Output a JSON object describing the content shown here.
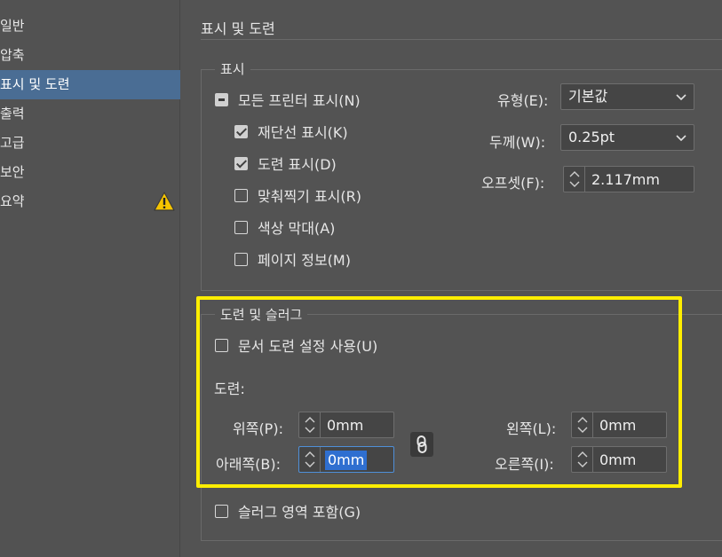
{
  "sidebar": {
    "items": [
      {
        "label": "일반"
      },
      {
        "label": "압축"
      },
      {
        "label": "표시 및 도련",
        "active": true
      },
      {
        "label": "출력"
      },
      {
        "label": "고급"
      },
      {
        "label": "보안"
      },
      {
        "label": "요약",
        "warning": true
      }
    ],
    "warning_icon": "warning-triangle-icon"
  },
  "panel": {
    "title": "표시 및 도련",
    "marks": {
      "legend": "표시",
      "all_printer_marks": {
        "label": "모든 프린터 표시(N)",
        "state": "mixed"
      },
      "crop_marks": {
        "label": "재단선 표시(K)",
        "checked": true
      },
      "bleed_marks": {
        "label": "도련 표시(D)",
        "checked": true
      },
      "registration_marks": {
        "label": "맞춰찍기 표시(R)",
        "checked": false
      },
      "color_bars": {
        "label": "색상 막대(A)",
        "checked": false
      },
      "page_info": {
        "label": "페이지 정보(M)",
        "checked": false
      },
      "type": {
        "label": "유형(E):",
        "value": "기본값"
      },
      "weight": {
        "label": "두께(W):",
        "value": "0.25pt"
      },
      "offset": {
        "label": "오프셋(F):",
        "value": "2.117mm"
      }
    },
    "bleed_slug": {
      "legend": "도련 및 슬러그",
      "use_document_bleed": {
        "label": "문서 도련 설정 사용(U)",
        "checked": false
      },
      "bleed_label": "도련:",
      "top": {
        "label": "위쪽(P):",
        "value": "0mm"
      },
      "bottom": {
        "label": "아래쪽(B):",
        "value": "0mm"
      },
      "left": {
        "label": "왼쪽(L):",
        "value": "0mm"
      },
      "right": {
        "label": "오른쪽(I):",
        "value": "0mm"
      },
      "link_icon": "chain-link-icon",
      "include_slug": {
        "label": "슬러그 영역 포함(G)",
        "checked": false
      }
    },
    "highlight_color": "#ffee00",
    "selection_color": "#2f6fd0"
  }
}
